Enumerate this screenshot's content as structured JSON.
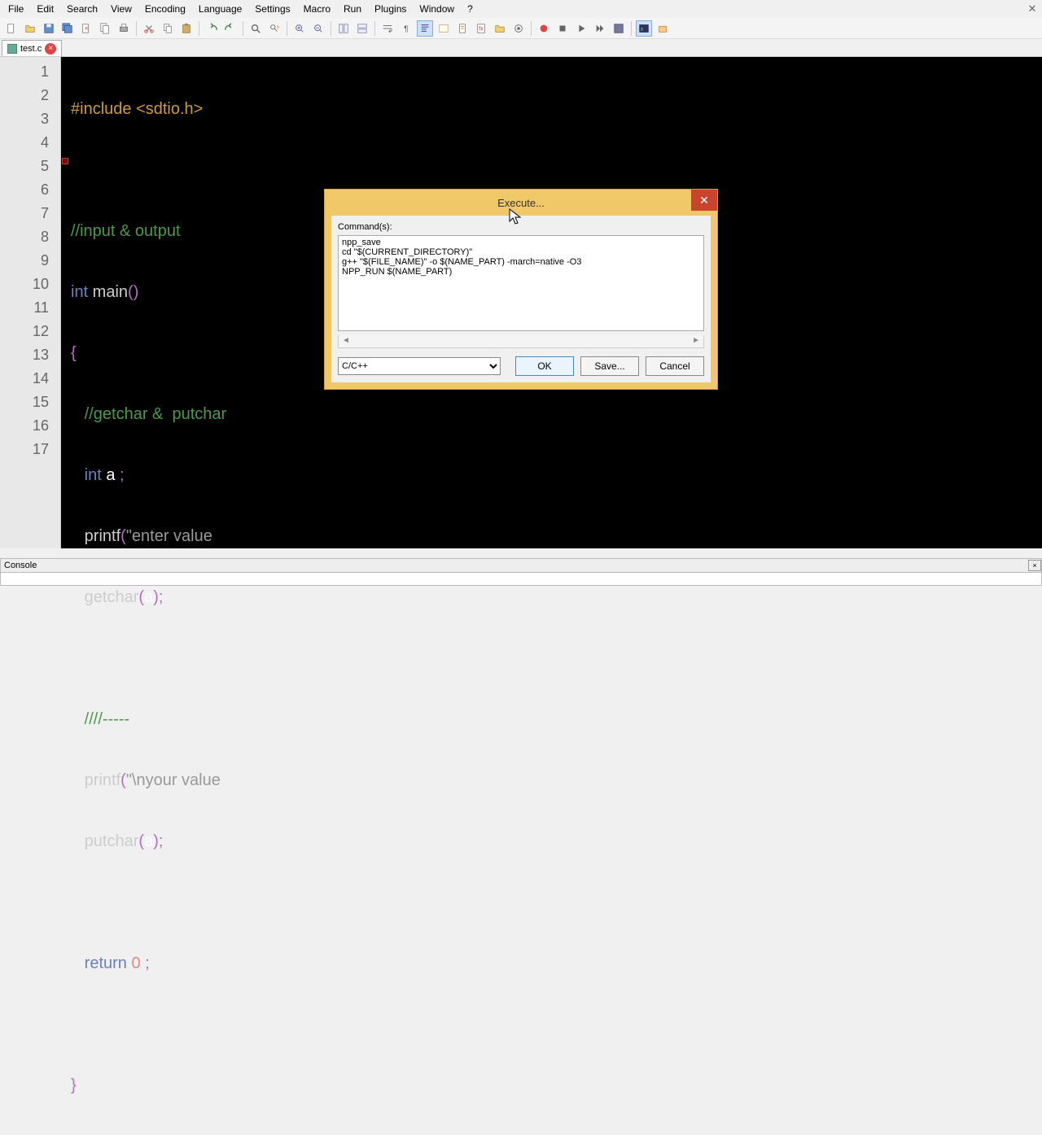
{
  "menubar": [
    "File",
    "Edit",
    "Search",
    "View",
    "Encoding",
    "Language",
    "Settings",
    "Macro",
    "Run",
    "Plugins",
    "Window",
    "?"
  ],
  "tab": {
    "name": "test.c"
  },
  "gutter_lines": [
    "1",
    "2",
    "3",
    "4",
    "5",
    "6",
    "7",
    "8",
    "9",
    "10",
    "11",
    "12",
    "13",
    "14",
    "15",
    "16",
    "17"
  ],
  "code": {
    "l1a": "#include ",
    "l1b": "<sdtio.h>",
    "l3": "//input & output",
    "l4a": "int",
    "l4b": " main",
    "l4c": "()",
    "l5": "{",
    "l6": "   //getchar &  putchar",
    "l7a": "   int",
    "l7b": " a ",
    "l7c": ";",
    "l8a": "   printf",
    "l8b": "(",
    "l8c": "\"enter value",
    "l8d": "",
    "l9a": "   getchar",
    "l9b": "(",
    "l9c": "a",
    "l9d": ");",
    "l11": "   ////-----",
    "l12a": "   printf",
    "l12b": "(",
    "l12c": "\"\\nyour value",
    "l13a": "   putchar",
    "l13b": "(",
    "l13c": "a",
    "l13d": ");",
    "l15a": "   return ",
    "l15b": "0",
    "l15c": " ;",
    "l17": "}"
  },
  "dialog": {
    "title": "Execute...",
    "label": "Command(s):",
    "commands": "npp_save\ncd \"$(CURRENT_DIRECTORY)\"\ng++ \"$(FILE_NAME)\" -o $(NAME_PART) -march=native -O3\nNPP_RUN $(NAME_PART)",
    "language": "C/C++",
    "ok": "OK",
    "save": "Save...",
    "cancel": "Cancel"
  },
  "console": {
    "title": "Console"
  }
}
